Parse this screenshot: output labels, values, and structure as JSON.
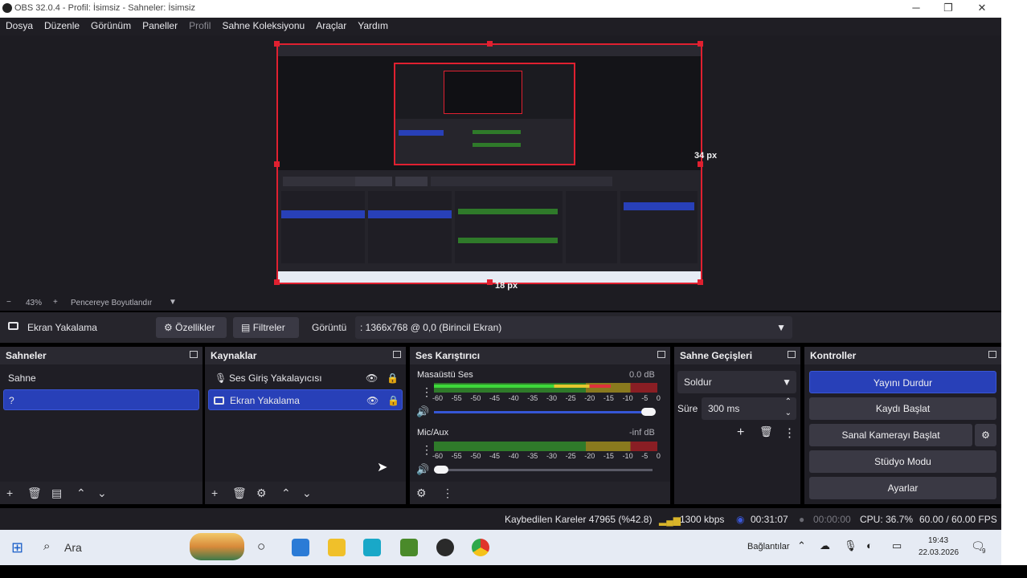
{
  "window": {
    "title": "OBS 32.0.4 - Profil: İsimsiz - Sahneler: İsimsiz"
  },
  "menu": [
    "Dosya",
    "Düzenle",
    "Görünüm",
    "Paneller",
    "Profil",
    "Sahne Koleksiyonu",
    "Araçlar",
    "Yardım"
  ],
  "preview": {
    "right_margin_label": "34 px",
    "bottom_margin_label": "18 px"
  },
  "zoom": {
    "minus": "−",
    "value": "43%",
    "plus": "+",
    "fit_label": "Pencereye Boyutlandır"
  },
  "context": {
    "source_name": "Ekran Yakalama",
    "properties_label": "Özellikler",
    "filters_label": "Filtreler",
    "display_label": "Görüntü",
    "display_value": ": 1366x768 @ 0,0 (Birincil Ekran)"
  },
  "scenes": {
    "title": "Sahneler",
    "items": [
      "Sahne",
      "?"
    ]
  },
  "sources": {
    "title": "Kaynaklar",
    "items": [
      "Ses Giriş Yakalayıcısı",
      "Ekran Yakalama"
    ]
  },
  "mixer": {
    "title": "Ses Karıştırıcı",
    "channels": [
      {
        "name": "Masaüstü Ses",
        "level": "0.0 dB"
      },
      {
        "name": "Mic/Aux",
        "level": "-inf dB"
      }
    ],
    "ticks": [
      "-60",
      "-55",
      "-50",
      "-45",
      "-40",
      "-35",
      "-30",
      "-25",
      "-20",
      "-15",
      "-10",
      "-5",
      "0"
    ]
  },
  "transitions": {
    "title": "Sahne Geçişleri",
    "selected": "Soldur",
    "duration_label": "Süre",
    "duration_value": "300 ms"
  },
  "controls": {
    "title": "Kontroller",
    "stop_stream": "Yayını Durdur",
    "start_record": "Kaydı Başlat",
    "virtual_cam": "Sanal Kamerayı Başlat",
    "studio_mode": "Stüdyo Modu",
    "settings": "Ayarlar"
  },
  "status": {
    "dropped": "Kaybedilen Kareler 47965 (%42.8)",
    "bitrate": "1300 kbps",
    "stream_time": "00:31:07",
    "record_time": "00:00:00",
    "cpu": "CPU: 36.7%",
    "fps": "60.00 / 60.00 FPS"
  },
  "taskbar": {
    "search_placeholder": "Ara",
    "network_label": "Bağlantılar",
    "time": "19:43",
    "date": "22.03.2026",
    "notif_count": "9"
  },
  "colors": {
    "accent": "#2840b8",
    "selection_border": "#e02030",
    "panel": "#1f1e25"
  }
}
